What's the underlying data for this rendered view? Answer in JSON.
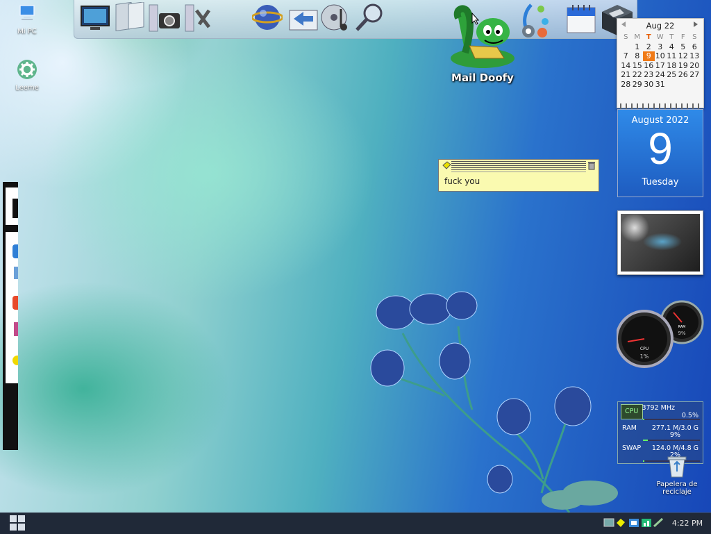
{
  "desktop_icons": [
    {
      "label": "Mi PC",
      "icon": "computer-icon"
    },
    {
      "label": "Leeme",
      "icon": "gear-icon"
    }
  ],
  "dock": {
    "items": [
      {
        "name": "monitor",
        "icon": "monitor-icon"
      },
      {
        "name": "folders",
        "icon": "folders-icon"
      },
      {
        "name": "camera",
        "icon": "camera-icon"
      },
      {
        "name": "tools",
        "icon": "tools-icon"
      },
      {
        "name": "internet",
        "icon": "globe-icon"
      },
      {
        "name": "transfer",
        "icon": "transfer-icon"
      },
      {
        "name": "media",
        "icon": "media-icon"
      },
      {
        "name": "search",
        "icon": "search-icon"
      },
      {
        "name": "settings",
        "icon": "settings-icon"
      },
      {
        "name": "calendar",
        "icon": "calendar-icon"
      },
      {
        "name": "box",
        "icon": "box-icon"
      }
    ]
  },
  "mail_doofy": {
    "label": "Mail Doofy"
  },
  "calendar": {
    "month": "Aug 22",
    "weekdays": [
      "S",
      "M",
      "T",
      "W",
      "T",
      "F",
      "S"
    ],
    "today_col": 2,
    "today": "9",
    "weeks": [
      [
        "",
        "1",
        "2",
        "3",
        "4",
        "5",
        "6"
      ],
      [
        "7",
        "8",
        "9",
        "10",
        "11",
        "12",
        "13"
      ],
      [
        "14",
        "15",
        "16",
        "17",
        "18",
        "19",
        "20"
      ],
      [
        "21",
        "22",
        "23",
        "24",
        "25",
        "26",
        "27"
      ],
      [
        "28",
        "29",
        "30",
        "31",
        "",
        "",
        ""
      ]
    ]
  },
  "big_date": {
    "month_year": "August 2022",
    "day": "9",
    "weekday": "Tuesday"
  },
  "sticky_note": {
    "text": "fuck you"
  },
  "gauges": {
    "cpu_label": "CPU",
    "cpu_value": "1%",
    "ram_label": "RAM",
    "ram_value": "9%"
  },
  "system_monitor": {
    "cpu": {
      "label": "CPU",
      "freq": "3792 MHz",
      "usage": "0.5%",
      "usage_fraction": 0.005
    },
    "ram": {
      "label": "RAM",
      "amount": "277.1 M/3.0 G",
      "usage": "9%",
      "usage_fraction": 0.09
    },
    "swap": {
      "label": "SWAP",
      "amount": "124.0 M/4.8 G",
      "usage": "2%",
      "usage_fraction": 0.02
    }
  },
  "recycle_bin": {
    "label": "Papelera de reciclaje"
  },
  "taskbar": {
    "start_icon": "windows-start-icon",
    "tray_icons": [
      "monitor-icon",
      "note-icon",
      "network-icon",
      "chart-icon",
      "usb-icon"
    ],
    "clock": "4:22 PM"
  },
  "colors": {
    "today": "#f07a16",
    "big_date_bg": "#2f8ae8",
    "note_bg": "#fafab0",
    "taskbar_bg": "#202938"
  }
}
